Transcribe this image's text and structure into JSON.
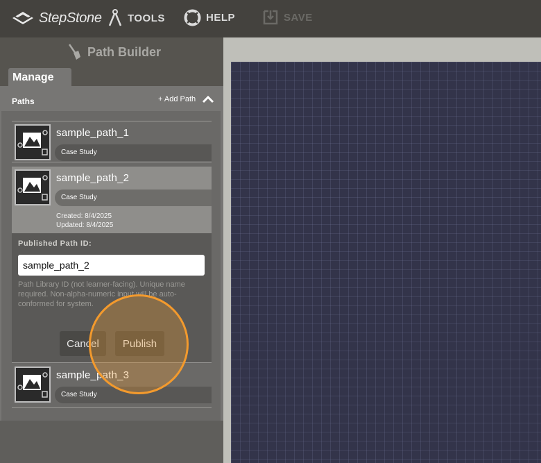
{
  "topbar": {
    "logo_text": "StepStone",
    "tools_label": "TOOLS",
    "help_label": "HELP",
    "save_label": "SAVE"
  },
  "panel": {
    "title": "Path Builder",
    "tab_manage": "Manage",
    "paths_label": "Paths",
    "add_path_label": "+ Add Path"
  },
  "paths": [
    {
      "name": "sample_path_1",
      "tag": "Case Study"
    },
    {
      "name": "sample_path_2",
      "tag": "Case Study",
      "created": "Created: 8/4/2025",
      "updated": "Updated: 8/4/2025"
    },
    {
      "name": "sample_path_3",
      "tag": "Case Study"
    }
  ],
  "edit": {
    "field_label": "Published Path ID:",
    "field_value": "sample_path_2",
    "hint": "Path Library ID (not learner-facing). Unique name required. Non-alpha-numeric input will be auto-conformed for system.",
    "cancel_label": "Cancel",
    "publish_label": "Publish"
  },
  "colors": {
    "accent_highlight": "#f39a2d",
    "canvas": "#33344a"
  }
}
